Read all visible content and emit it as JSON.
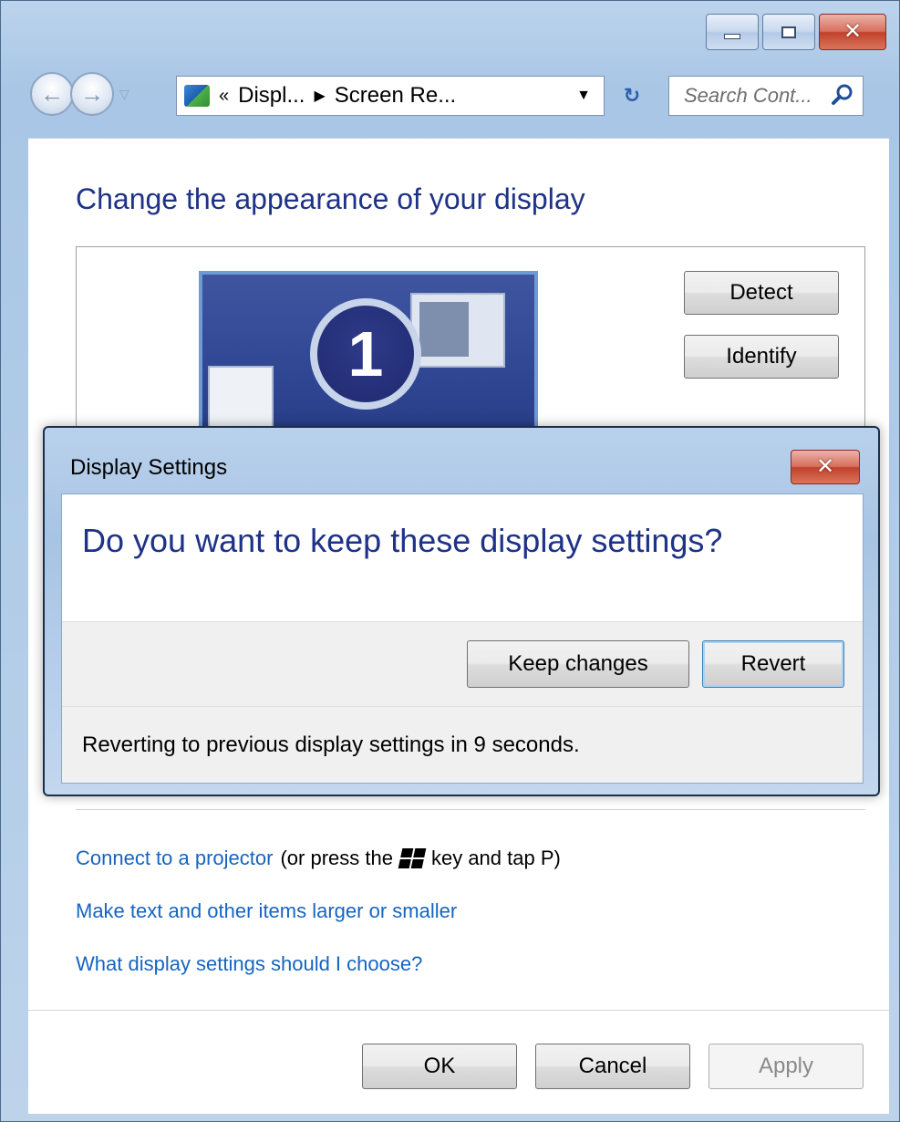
{
  "window": {
    "caption": {
      "minimize": "minimize",
      "maximize": "maximize",
      "close": "close"
    }
  },
  "navbar": {
    "address": {
      "prefix": "«",
      "crumbs": [
        "Displ...",
        "Screen Re..."
      ]
    },
    "search_placeholder": "Search Cont..."
  },
  "main": {
    "title": "Change the appearance of your display",
    "monitor_number": "1",
    "detect_label": "Detect",
    "identify_label": "Identify",
    "links": {
      "projector": "Connect to a projector",
      "projector_hint_before": "(or press the",
      "projector_hint_after": "key and tap P)",
      "text_size": "Make text and other items larger or smaller",
      "which_settings": "What display settings should I choose?"
    },
    "footer": {
      "ok": "OK",
      "cancel": "Cancel",
      "apply": "Apply"
    }
  },
  "dialog": {
    "title": "Display Settings",
    "question": "Do you want to keep these display settings?",
    "keep_label": "Keep changes",
    "revert_label": "Revert",
    "status": "Reverting to previous display settings in 9 seconds."
  },
  "colors": {
    "link": "#1565c0",
    "heading": "#1e3287",
    "close_red": "#c2412c",
    "chrome_blue": "#a9c6e6"
  }
}
